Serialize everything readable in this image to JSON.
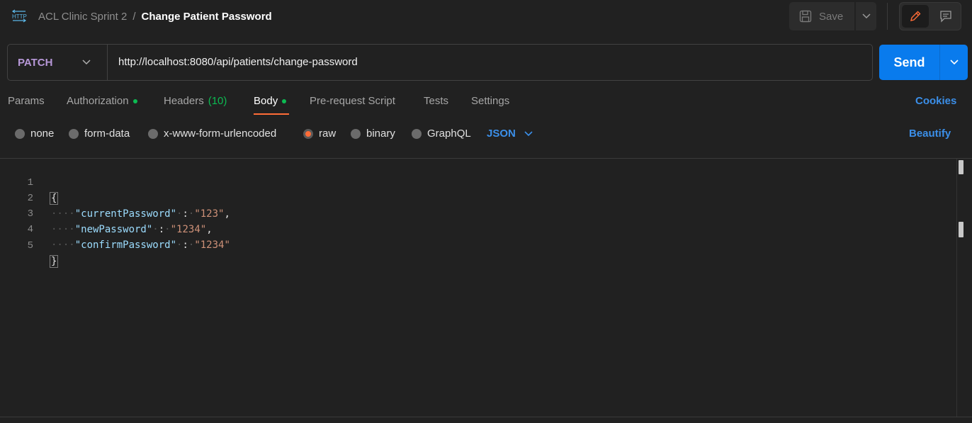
{
  "header": {
    "collection": "ACL Clinic Sprint 2",
    "separator": "/",
    "title": "Change Patient Password",
    "http_icon_label": "HTTP",
    "save_label": "Save"
  },
  "request": {
    "method": "PATCH",
    "url": "http://localhost:8080/api/patients/change-password",
    "send_label": "Send"
  },
  "tabs": [
    {
      "label": "Params"
    },
    {
      "label": "Authorization"
    },
    {
      "label": "Headers",
      "count": "(10)"
    },
    {
      "label": "Body"
    },
    {
      "label": "Pre-request Script"
    },
    {
      "label": "Tests"
    },
    {
      "label": "Settings"
    }
  ],
  "cookies_label": "Cookies",
  "body_types": [
    "none",
    "form-data",
    "x-www-form-urlencoded",
    "raw",
    "binary",
    "GraphQL"
  ],
  "selected_body_type": "raw",
  "format": "JSON",
  "beautify_label": "Beautify",
  "editor": {
    "line_numbers": [
      "1",
      "2",
      "3",
      "4",
      "5"
    ],
    "open_brace": "{",
    "close_brace": "}",
    "fields": [
      {
        "key": "\"currentPassword\"",
        "value": "\"123\"",
        "comma": ","
      },
      {
        "key": "\"newPassword\"",
        "value": "\"1234\"",
        "comma": ","
      },
      {
        "key": "\"confirmPassword\"",
        "value": "\"1234\"",
        "comma": ""
      }
    ]
  },
  "colors": {
    "accent": "#ff6c37",
    "primary": "#097bed",
    "link": "#3b8fe9",
    "method": "#b798d8",
    "status_dot": "#0cbb52"
  }
}
